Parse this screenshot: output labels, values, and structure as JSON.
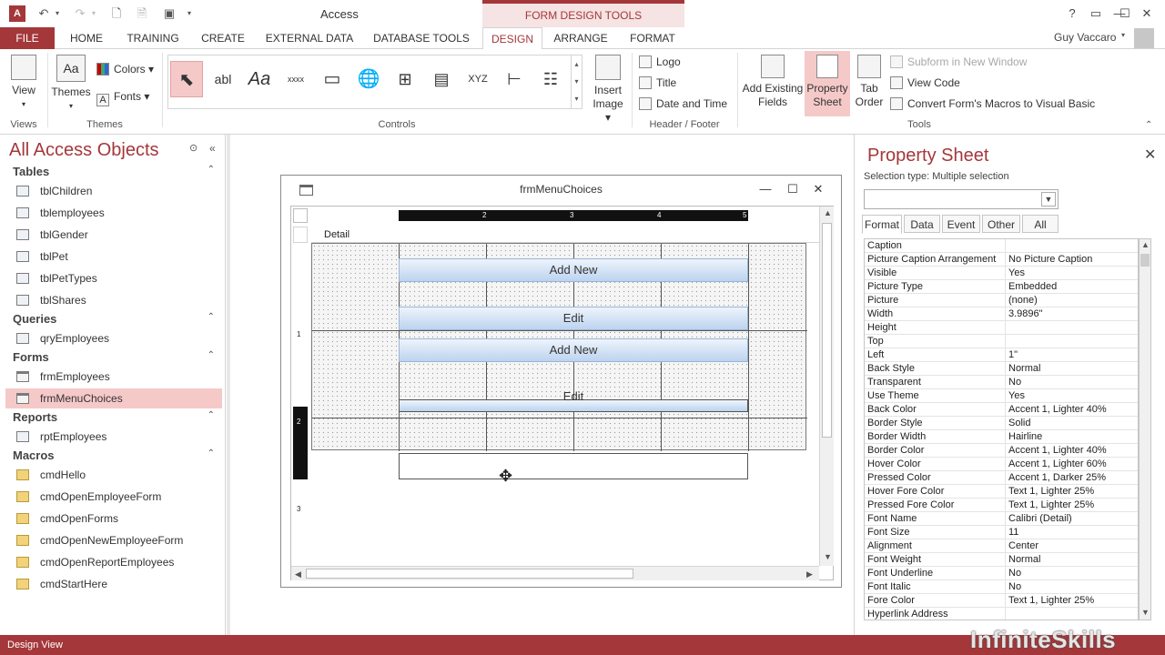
{
  "titlebar": {
    "app_logo": "A",
    "app_title": "Access",
    "context_title": "FORM DESIGN TOOLS",
    "help_label": "?"
  },
  "tabs": [
    {
      "label": "FILE"
    },
    {
      "label": "HOME"
    },
    {
      "label": "TRAINING"
    },
    {
      "label": "CREATE"
    },
    {
      "label": "EXTERNAL DATA"
    },
    {
      "label": "DATABASE TOOLS"
    },
    {
      "label": "DESIGN"
    },
    {
      "label": "ARRANGE"
    },
    {
      "label": "FORMAT"
    }
  ],
  "user": {
    "name": "Guy Vaccaro"
  },
  "ribbon": {
    "views": {
      "view_label": "View",
      "group": "Views"
    },
    "themes": {
      "themes_label": "Themes",
      "colors_label": "Colors",
      "fonts_label": "Fonts",
      "group": "Themes"
    },
    "controls": {
      "group": "Controls",
      "gallery": [
        "abl",
        "Aa",
        "xxxx",
        "XYZ"
      ],
      "insert_image": "Insert",
      "insert_image_2": "Image"
    },
    "header_footer": {
      "logo": "Logo",
      "title": "Title",
      "date_time": "Date and Time",
      "group": "Header / Footer"
    },
    "tools": {
      "add_existing": "Add Existing",
      "add_existing_2": "Fields",
      "property": "Property",
      "property_2": "Sheet",
      "tab_order": "Tab",
      "tab_order_2": "Order",
      "subform": "Subform in New Window",
      "view_code": "View Code",
      "convert": "Convert Form's Macros to Visual Basic",
      "group": "Tools"
    }
  },
  "nav": {
    "title": "All Access Objects",
    "tables_header": "Tables",
    "tables": [
      "tblChildren",
      "tblemployees",
      "tblGender",
      "tblPet",
      "tblPetTypes",
      "tblShares"
    ],
    "queries_header": "Queries",
    "queries": [
      "qryEmployees"
    ],
    "forms_header": "Forms",
    "forms": [
      "frmEmployees",
      "frmMenuChoices"
    ],
    "reports_header": "Reports",
    "reports": [
      "rptEmployees"
    ],
    "macros_header": "Macros",
    "macros": [
      "cmdHello",
      "cmdOpenEmployeeForm",
      "cmdOpenForms",
      "cmdOpenNewEmployeeForm",
      "cmdOpenReportEmployees",
      "cmdStartHere"
    ]
  },
  "form": {
    "caption": "frmMenuChoices",
    "detail_label": "Detail",
    "ruler_h": [
      "2",
      "3",
      "4",
      "5"
    ],
    "ruler_v": [
      "1",
      "2",
      "3"
    ],
    "buttons": [
      "Add New",
      "Edit",
      "Add New",
      "Edit"
    ]
  },
  "property_sheet": {
    "title": "Property Sheet",
    "selection_type": "Selection type:  Multiple selection",
    "tabs": [
      "Format",
      "Data",
      "Event",
      "Other",
      "All"
    ],
    "rows": [
      [
        "Caption",
        ""
      ],
      [
        "Picture Caption Arrangement",
        "No Picture Caption"
      ],
      [
        "Visible",
        "Yes"
      ],
      [
        "Picture Type",
        "Embedded"
      ],
      [
        "Picture",
        "(none)"
      ],
      [
        "Width",
        "3.9896\""
      ],
      [
        "Height",
        ""
      ],
      [
        "Top",
        ""
      ],
      [
        "Left",
        "1\""
      ],
      [
        "Back Style",
        "Normal"
      ],
      [
        "Transparent",
        "No"
      ],
      [
        "Use Theme",
        "Yes"
      ],
      [
        "Back Color",
        "Accent 1, Lighter 40%"
      ],
      [
        "Border Style",
        "Solid"
      ],
      [
        "Border Width",
        "Hairline"
      ],
      [
        "Border Color",
        "Accent 1, Lighter 40%"
      ],
      [
        "Hover Color",
        "Accent 1, Lighter 60%"
      ],
      [
        "Pressed Color",
        "Accent 1, Darker 25%"
      ],
      [
        "Hover Fore Color",
        "Text 1, Lighter 25%"
      ],
      [
        "Pressed Fore Color",
        "Text 1, Lighter 25%"
      ],
      [
        "Font Name",
        "Calibri (Detail)"
      ],
      [
        "Font Size",
        "11"
      ],
      [
        "Alignment",
        "Center"
      ],
      [
        "Font Weight",
        "Normal"
      ],
      [
        "Font Underline",
        "No"
      ],
      [
        "Font Italic",
        "No"
      ],
      [
        "Fore Color",
        "Text 1, Lighter 25%"
      ],
      [
        "Hyperlink Address",
        ""
      ]
    ]
  },
  "status": {
    "text": "Design View"
  },
  "watermark": "InfiniteSkills",
  "colors": {
    "accent": "#a4373a",
    "selection": "#f6c9c9",
    "button_top": "#eef4fc",
    "button_bottom": "#bcd3ef"
  }
}
